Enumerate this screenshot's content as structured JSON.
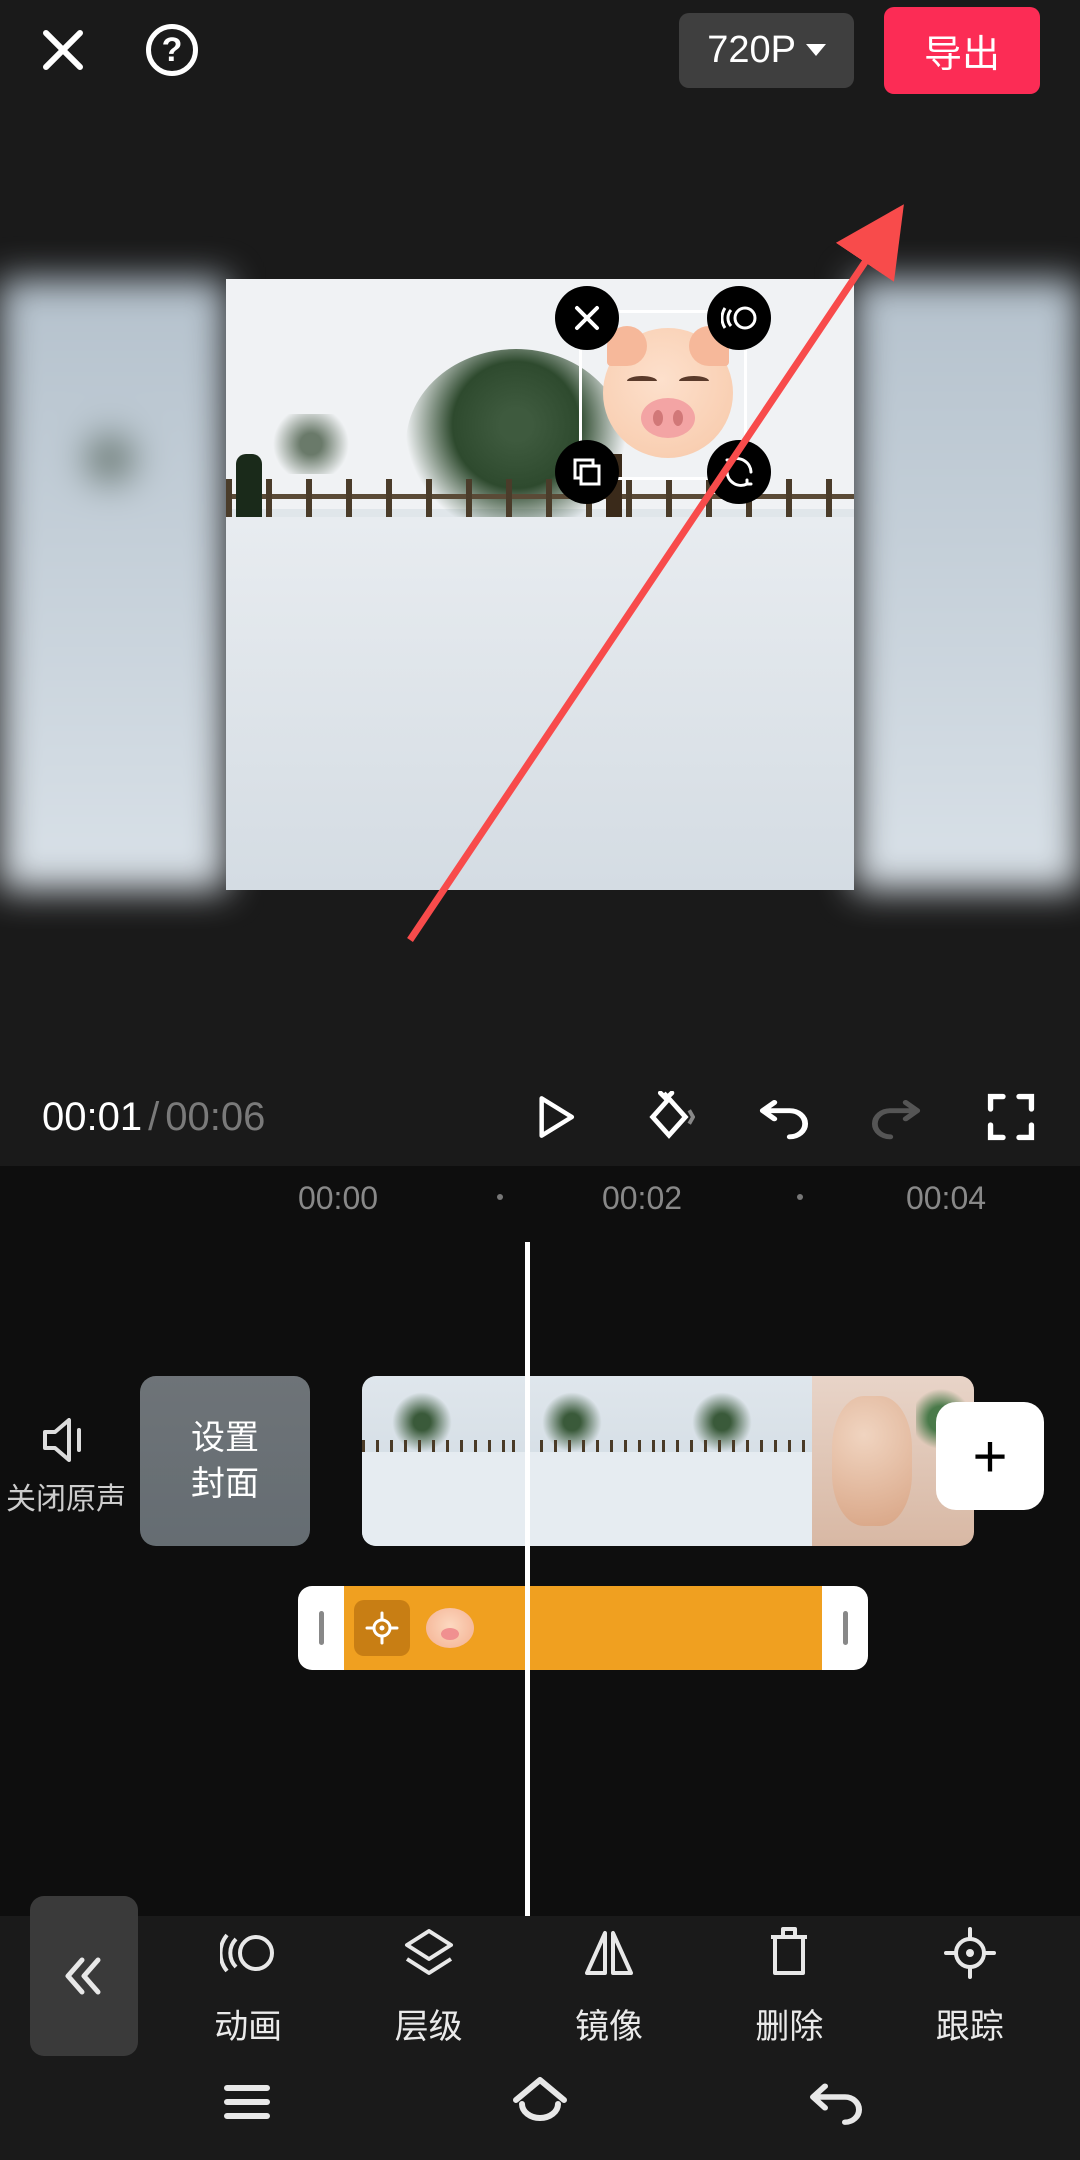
{
  "header": {
    "resolution": "720P",
    "export_label": "导出"
  },
  "sticker_handles": {
    "delete": "close-icon",
    "animate": "motion-icon",
    "copy": "copy-icon",
    "rotate": "rotate-icon"
  },
  "transport": {
    "current": "00:01",
    "total": "00:06"
  },
  "timeline": {
    "ticks": [
      "00:00",
      "00:02",
      "00:04"
    ],
    "mute_label": "关闭原声",
    "cover_line1": "设置",
    "cover_line2": "封面",
    "add_label": "+"
  },
  "toolbar": {
    "collapse": "«",
    "items": [
      {
        "id": "animation",
        "label": "动画"
      },
      {
        "id": "layer",
        "label": "层级"
      },
      {
        "id": "mirror",
        "label": "镜像"
      },
      {
        "id": "delete",
        "label": "删除"
      },
      {
        "id": "track",
        "label": "跟踪"
      }
    ]
  }
}
